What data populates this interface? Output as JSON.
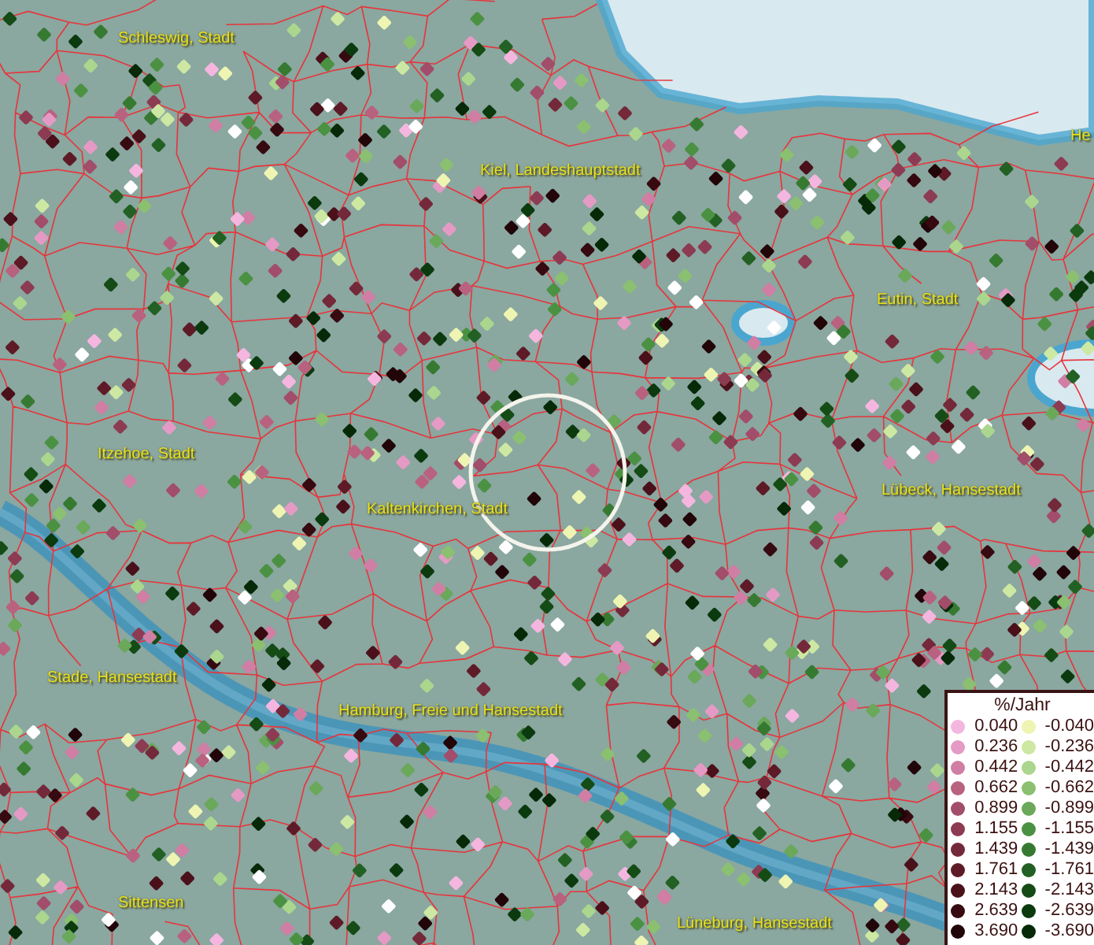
{
  "map": {
    "places": [
      {
        "name": "Schleswig, Stadt"
      },
      {
        "name": "Kiel, Landeshauptstadt"
      },
      {
        "name": "He"
      },
      {
        "name": "Eutin, Stadt"
      },
      {
        "name": "Itzehoe, Stadt"
      },
      {
        "name": "Kaltenkirchen, Stadt"
      },
      {
        "name": "Lübeck, Hansestadt"
      },
      {
        "name": "Stade, Hansestadt"
      },
      {
        "name": "Hamburg, Freie und Hansestadt"
      },
      {
        "name": "Sittensen"
      },
      {
        "name": "Lüneburg, Hansestadt"
      }
    ]
  },
  "legend": {
    "title": "%/Jahr",
    "left_column": [
      {
        "label": "0.040",
        "color": "#f4b6df"
      },
      {
        "label": "0.236",
        "color": "#e49ac4"
      },
      {
        "label": "0.442",
        "color": "#d07ea4"
      },
      {
        "label": "0.662",
        "color": "#b8627f"
      },
      {
        "label": "0.899",
        "color": "#a24d69"
      },
      {
        "label": "1.155",
        "color": "#8c3b53"
      },
      {
        "label": "1.439",
        "color": "#74293b"
      },
      {
        "label": "1.761",
        "color": "#5e1b27"
      },
      {
        "label": "2.143",
        "color": "#4a111a"
      },
      {
        "label": "2.639",
        "color": "#360a10"
      },
      {
        "label": "3.690",
        "color": "#210508"
      }
    ],
    "right_column": [
      {
        "label": "-0.040",
        "color": "#eef4b2"
      },
      {
        "label": "-0.236",
        "color": "#cce8a2"
      },
      {
        "label": "-0.442",
        "color": "#aad68e"
      },
      {
        "label": "-0.662",
        "color": "#8ac070"
      },
      {
        "label": "-0.899",
        "color": "#6aa85a"
      },
      {
        "label": "-1.155",
        "color": "#4b9142"
      },
      {
        "label": "-1.439",
        "color": "#367a31"
      },
      {
        "label": "-1.761",
        "color": "#226123"
      },
      {
        "label": "-2.143",
        "color": "#154b15"
      },
      {
        "label": "-2.639",
        "color": "#0b3a0f"
      },
      {
        "label": "-3.690",
        "color": "#062908"
      }
    ]
  }
}
